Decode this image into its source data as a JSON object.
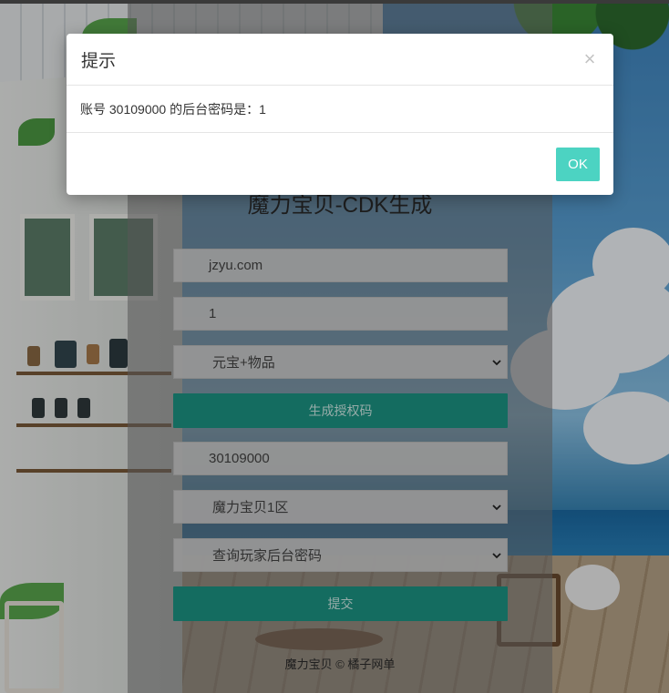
{
  "page": {
    "title": "魔力宝贝-CDK生成",
    "footer": "魔力宝贝 © 橘子网单"
  },
  "form1": {
    "site_value": "jzyu.com",
    "quantity_value": "1",
    "type_select": "元宝+物品",
    "generate_button": "生成授权码"
  },
  "form2": {
    "account_value": "30109000",
    "server_select": "魔力宝贝1区",
    "action_select": "查询玩家后台密码",
    "submit_button": "提交"
  },
  "modal": {
    "title": "提示",
    "close": "×",
    "message": "账号 30109000 的后台密码是：1",
    "ok_button": "OK"
  },
  "colors": {
    "accent": "#1d9685",
    "ok_button": "#4cd3c2"
  }
}
